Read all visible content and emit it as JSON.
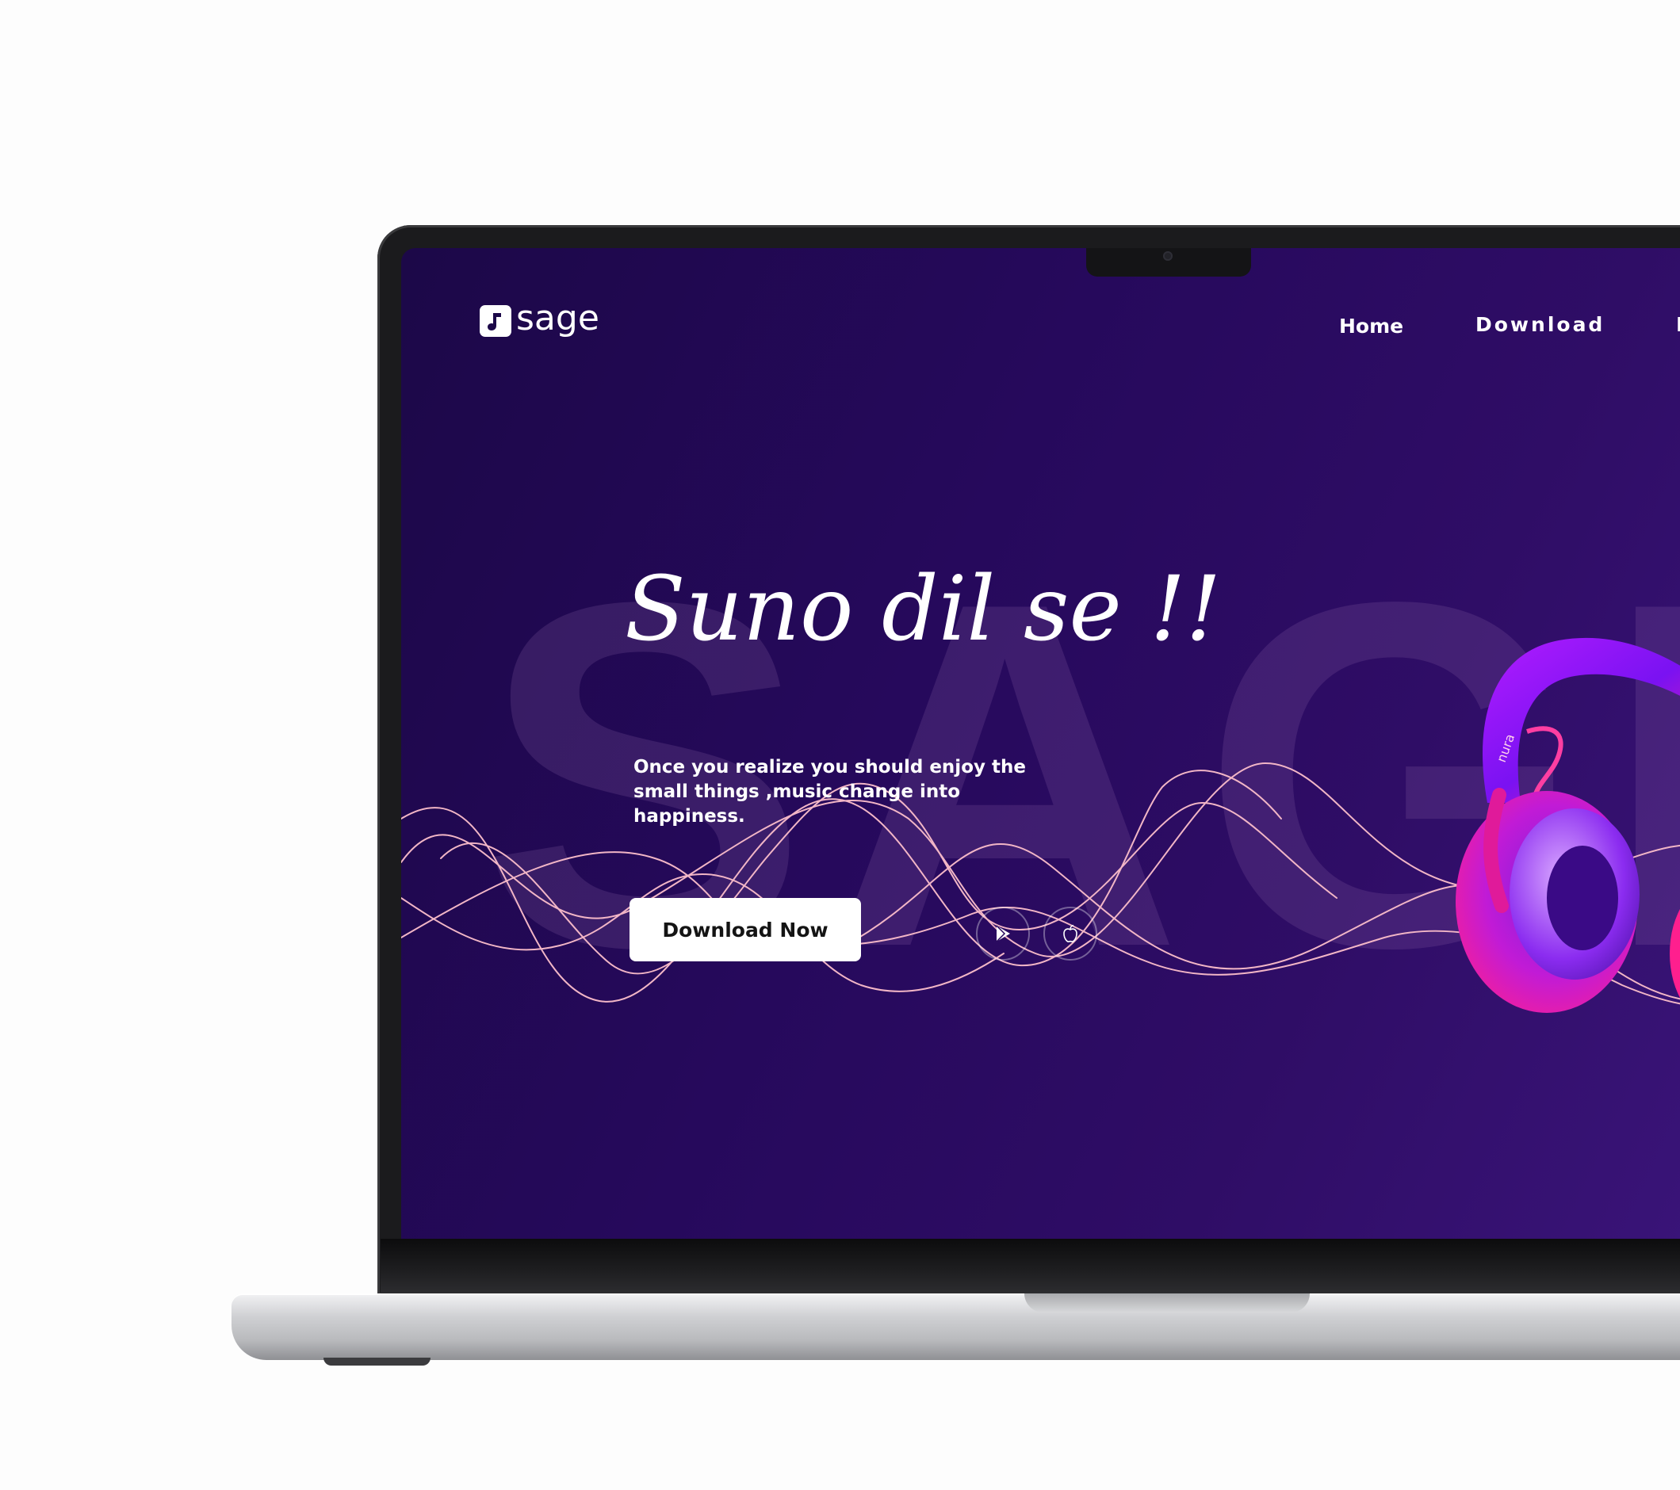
{
  "brand": {
    "name": "sage",
    "logo_icon": "music-note-icon"
  },
  "nav": {
    "items": [
      {
        "label": "Home"
      },
      {
        "label": "Download"
      },
      {
        "label": "I"
      }
    ]
  },
  "background_word": "SAGE",
  "hero": {
    "title": "Suno dil se !!",
    "subtitle_line1": "Once you realize you should enjoy the",
    "subtitle_line2": "small things ,music change into happiness.",
    "cta_label": "Download Now"
  },
  "store_icons": [
    "google-play-icon",
    "apple-icon"
  ],
  "product": {
    "name": "headphones",
    "brand_text": "nura"
  },
  "colors": {
    "background_start": "#1c0848",
    "background_end": "#3a1479",
    "wave_line": "#f2b6c6",
    "headphone_pink": "#ff1f8e",
    "headphone_purple": "#8a12ff",
    "button_bg": "#ffffff",
    "button_text": "#141414"
  }
}
